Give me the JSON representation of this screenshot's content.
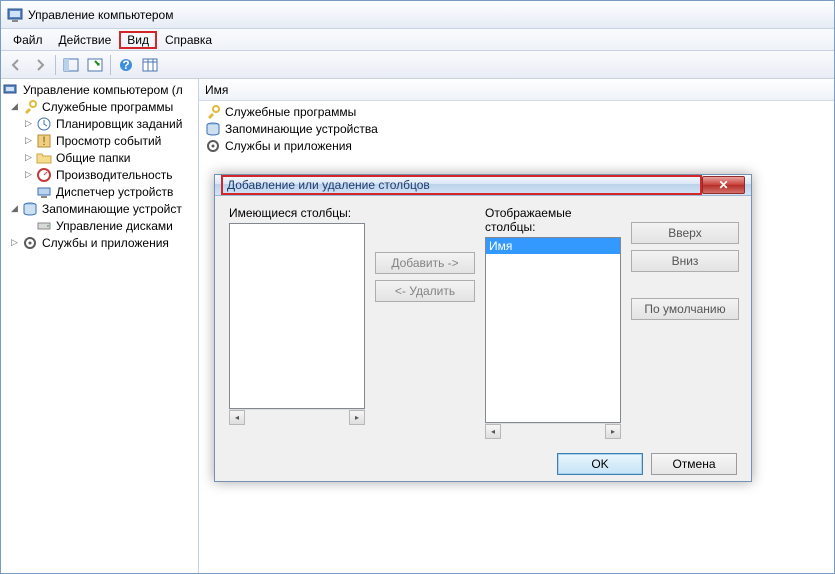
{
  "window": {
    "title": "Управление компьютером"
  },
  "menu": {
    "file": "Файл",
    "action": "Действие",
    "view": "Вид",
    "help": "Справка"
  },
  "tree": {
    "root": "Управление компьютером (л",
    "svc_programs": "Служебные программы",
    "scheduler": "Планировщик заданий",
    "eventviewer": "Просмотр событий",
    "shared": "Общие папки",
    "perf": "Производительность",
    "devmgr": "Диспетчер устройств",
    "storage": "Запоминающие устройст",
    "diskmgmt": "Управление дисками",
    "services": "Службы и приложения"
  },
  "list": {
    "header": "Имя",
    "rows": {
      "svc": "Служебные программы",
      "storage": "Запоминающие устройства",
      "services": "Службы и приложения"
    }
  },
  "dialog": {
    "title": "Добавление или удаление столбцов",
    "available_label": "Имеющиеся столбцы:",
    "displayed_label": "Отображаемые столбцы:",
    "add": "Добавить ->",
    "remove": "<- Удалить",
    "up": "Вверх",
    "down": "Вниз",
    "default": "По умолчанию",
    "ok": "OK",
    "cancel": "Отмена",
    "displayed_items": {
      "name": "Имя"
    }
  }
}
